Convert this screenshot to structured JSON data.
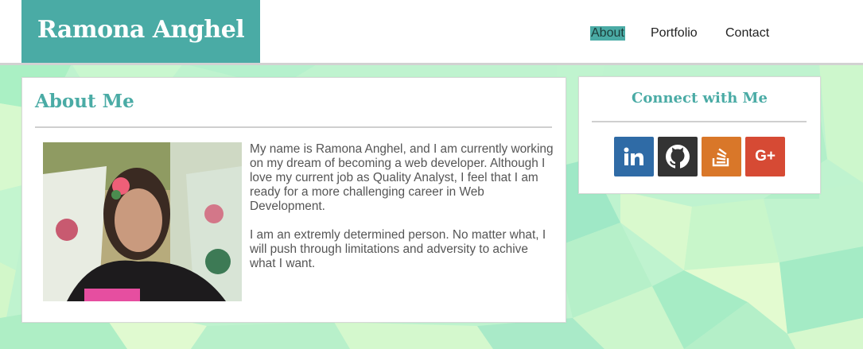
{
  "header": {
    "site_title": "Ramona Anghel"
  },
  "nav": {
    "items": [
      {
        "label": "About",
        "active": true
      },
      {
        "label": "Portfolio",
        "active": false
      },
      {
        "label": "Contact",
        "active": false
      }
    ]
  },
  "about": {
    "heading": "About Me",
    "paragraphs": [
      "My name is Ramona Anghel, and I am currently working on my dream of becoming a web developer. Although I love my current job as Quality Analyst, I feel that I am ready for a more challenging career in Web Development.",
      "I am an extremly determined person. No matter what, I will push through limitations and adversity to achive what I want."
    ]
  },
  "connect": {
    "heading": "Connect with Me",
    "links": [
      {
        "icon": "linkedin-icon",
        "text": "in",
        "color": "#2f6ba6"
      },
      {
        "icon": "github-icon",
        "color": "#333333"
      },
      {
        "icon": "stackoverflow-icon",
        "color": "#d97729"
      },
      {
        "icon": "google-plus-icon",
        "text": "G+",
        "color": "#d64a34"
      }
    ]
  },
  "colors": {
    "accent": "#4aaba5",
    "background": "#bff3cf"
  }
}
